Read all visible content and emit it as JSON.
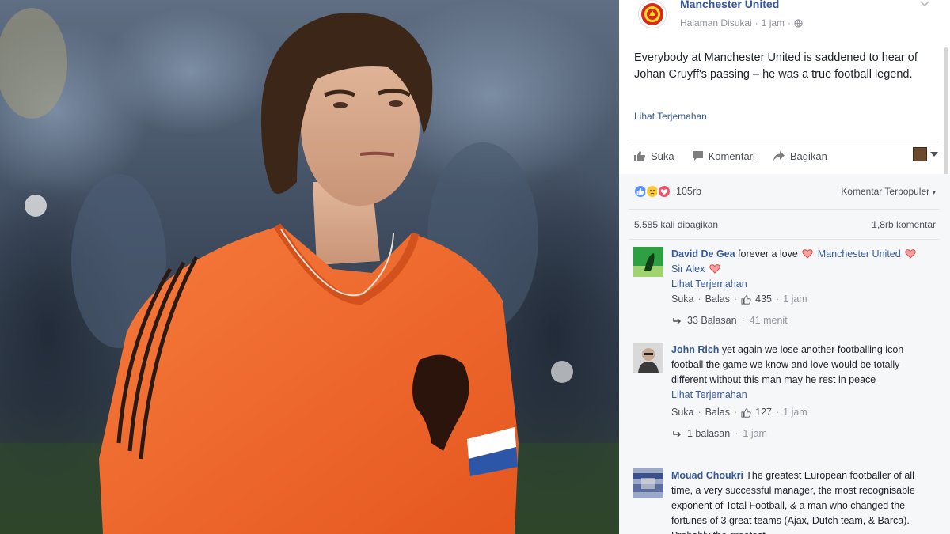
{
  "post": {
    "page_name": "Manchester United",
    "page_meta": "Halaman Disukai",
    "time": "1 jam",
    "text": "Everybody at Manchester United is saddened to hear of Johan Cruyff's passing – he was a true football legend.",
    "translate": "Lihat Terjemahan"
  },
  "actions": {
    "like": "Suka",
    "comment": "Komentari",
    "share": "Bagikan"
  },
  "reactions": {
    "count": "105rb",
    "sort": "Komentar Terpopuler"
  },
  "stats": {
    "shares": "5.585 kali dibagikan",
    "comments": "1,8rb komentar"
  },
  "comments": [
    {
      "author": "David De Gea",
      "text_parts": [
        "forever a love",
        "Manchester United",
        "Sir Alex"
      ],
      "translate": "Lihat Terjemahan",
      "like": "Suka",
      "reply": "Balas",
      "likes": "435",
      "time": "1 jam",
      "replies": "33 Balasan",
      "replies_time": "41 menit"
    },
    {
      "author": "John Rich",
      "text": "yet again we lose another footballing icon football the game we know and love would be totally different without this man may he rest in peace",
      "translate": "Lihat Terjemahan",
      "like": "Suka",
      "reply": "Balas",
      "likes": "127",
      "time": "1 jam",
      "replies": "1 balasan",
      "replies_time": "1 jam"
    },
    {
      "author": "Mouad Choukri",
      "text": "The greatest European footballer of all time, a very successful manager, the most recognisable exponent of Total Football, & a man who changed the fortunes of 3 great teams (Ajax, Dutch team, & Barca). Probably the greatest"
    }
  ],
  "colors": {
    "link": "#365899",
    "meta": "#90949c",
    "jersey": "#f0652a"
  }
}
